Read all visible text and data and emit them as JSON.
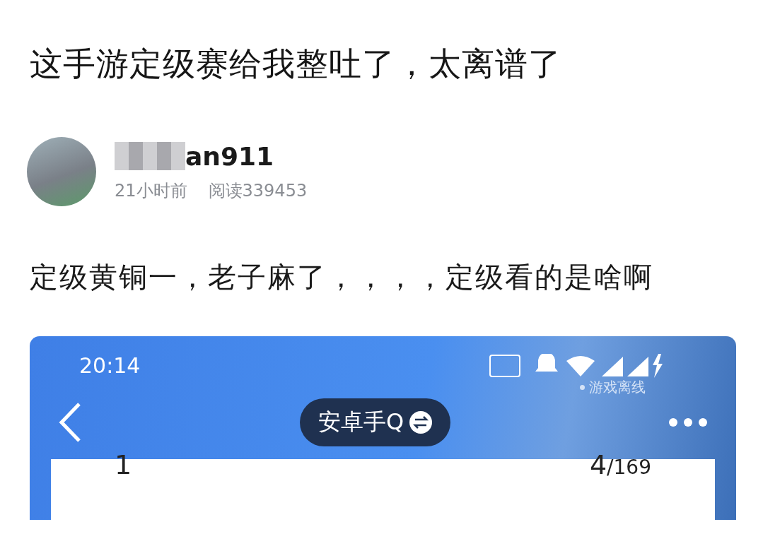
{
  "post": {
    "title": "这手游定级赛给我整吐了，太离谱了",
    "author": {
      "name": "an911",
      "time": "21小时前",
      "reads": "阅读339453"
    },
    "body": "定级黄铜一，老子麻了，，，，定级看的是啥啊"
  },
  "screenshot": {
    "clock": "20:14",
    "game_status": "游戏离线",
    "account": "安卓手Q",
    "stats": [
      {
        "value": "1"
      },
      {
        "value": "4",
        "total": "/169"
      }
    ]
  }
}
